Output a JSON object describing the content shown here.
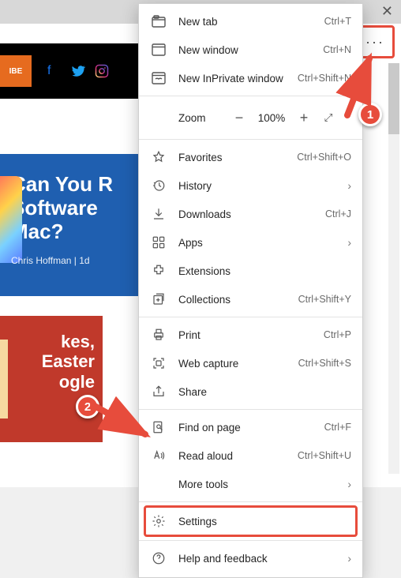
{
  "window": {
    "close_glyph": "✕"
  },
  "toolbar": {
    "more_glyph": "···"
  },
  "background": {
    "subscribe": "IBE",
    "card1": {
      "title": "Can You R\nSoftware \nMac?",
      "byline": "Chris Hoffman  |  1d"
    },
    "card2": {
      "title": "kes,\nEaster\nogle"
    }
  },
  "callouts": {
    "one": "1",
    "two": "2"
  },
  "menu": {
    "new_tab": {
      "label": "New tab",
      "shortcut": "Ctrl+T"
    },
    "new_window": {
      "label": "New window",
      "shortcut": "Ctrl+N"
    },
    "new_inprivate": {
      "label": "New InPrivate window",
      "shortcut": "Ctrl+Shift+N"
    },
    "zoom": {
      "label": "Zoom",
      "minus": "−",
      "value": "100%",
      "plus": "+",
      "full": "⤢"
    },
    "favorites": {
      "label": "Favorites",
      "shortcut": "Ctrl+Shift+O"
    },
    "history": {
      "label": "History",
      "chevron": "›"
    },
    "downloads": {
      "label": "Downloads",
      "shortcut": "Ctrl+J"
    },
    "apps": {
      "label": "Apps",
      "chevron": "›"
    },
    "extensions": {
      "label": "Extensions"
    },
    "collections": {
      "label": "Collections",
      "shortcut": "Ctrl+Shift+Y"
    },
    "print": {
      "label": "Print",
      "shortcut": "Ctrl+P"
    },
    "web_capture": {
      "label": "Web capture",
      "shortcut": "Ctrl+Shift+S"
    },
    "share": {
      "label": "Share"
    },
    "find": {
      "label": "Find on page",
      "shortcut": "Ctrl+F"
    },
    "read_aloud": {
      "label": "Read aloud",
      "shortcut": "Ctrl+Shift+U"
    },
    "more_tools": {
      "label": "More tools",
      "chevron": "›"
    },
    "settings": {
      "label": "Settings"
    },
    "help": {
      "label": "Help and feedback",
      "chevron": "›"
    }
  }
}
